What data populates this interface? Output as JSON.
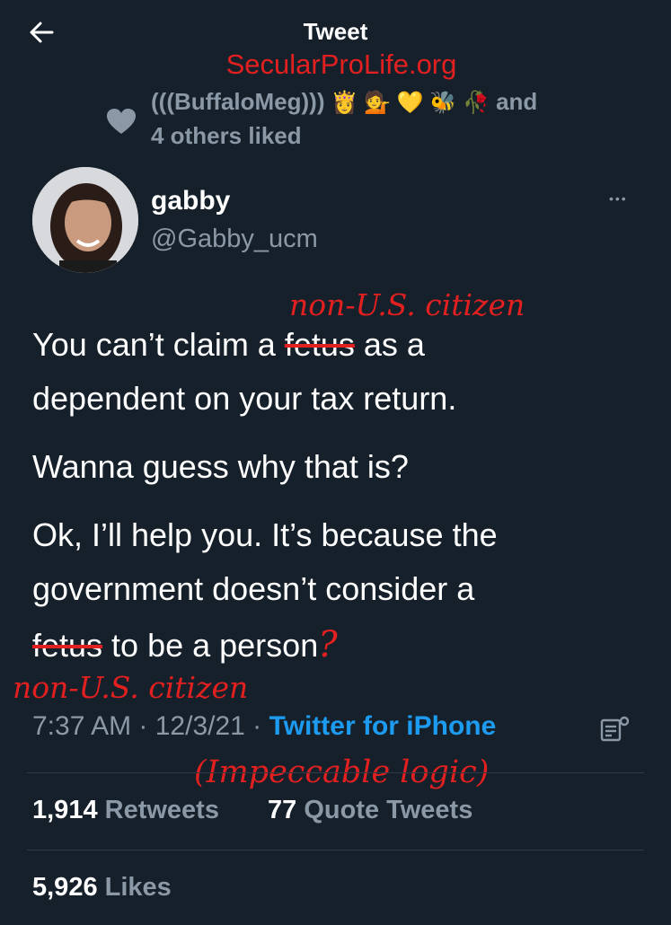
{
  "header": {
    "title": "Tweet",
    "watermark": "SecularProLife.org"
  },
  "social_context": {
    "line1": "(((BuffaloMeg)))",
    "emojis": "👸 💁 💛 🐝 🥀",
    "and_text": "and",
    "line2": "4 others liked"
  },
  "author": {
    "name": "gabby",
    "handle": "@Gabby_ucm",
    "more": "•••"
  },
  "tweet": {
    "p1_before": "You can’t claim a ",
    "p1_struck": "fetus",
    "p1_after": " as a",
    "p1_line2": "dependent on your tax return.",
    "p2": "Wanna guess why that is?",
    "p3_line1": "Ok, I’ll help you. It’s because the",
    "p3_line2": "government doesn’t consider a",
    "p3_struck": "fetus",
    "p3_after": " to be a person",
    "question_mark": "?"
  },
  "annotations": {
    "edit_1": "non-U.S. citizen",
    "edit_2": "non-U.S. citizen",
    "comment": "(Impeccable logic)"
  },
  "meta": {
    "time": "7:37 AM",
    "sep1": " · ",
    "date": "12/3/21",
    "sep2": " · ",
    "source": "Twitter for iPhone"
  },
  "stats": {
    "retweets_count": "1,914",
    "retweets_label": "Retweets",
    "quotes_count": "77",
    "quotes_label": "Quote Tweets",
    "likes_count": "5,926",
    "likes_label": "Likes"
  },
  "colors": {
    "background": "#15202b",
    "link": "#1d9bf0",
    "annotation": "#e32020"
  }
}
